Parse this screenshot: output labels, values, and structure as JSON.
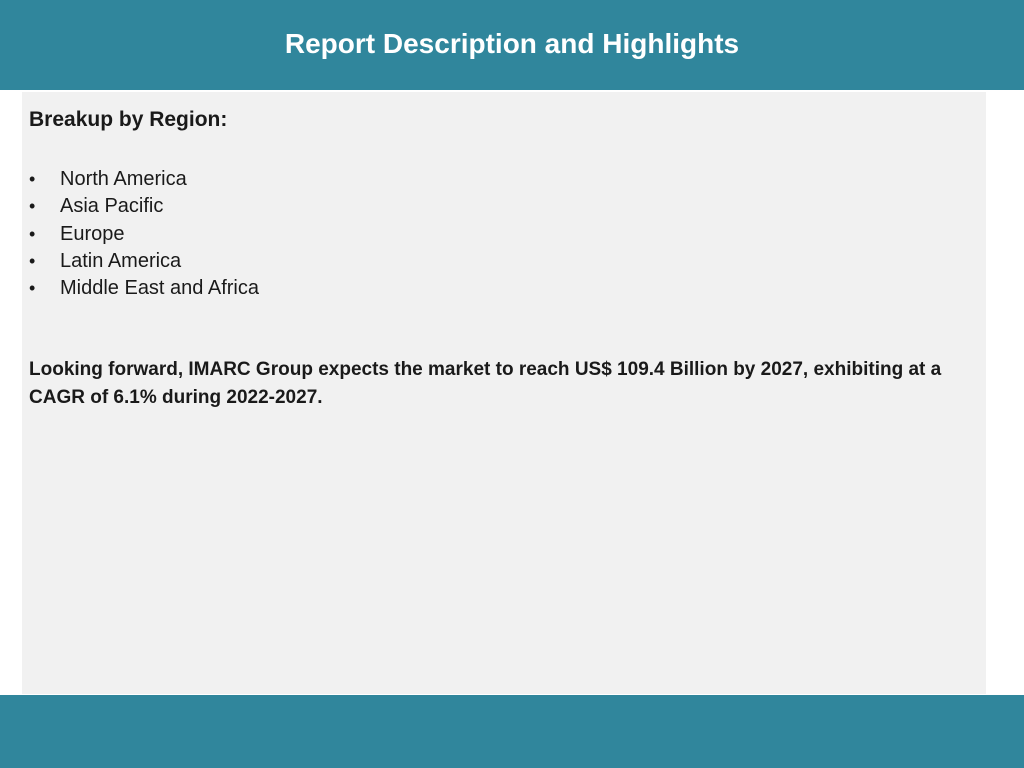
{
  "header": {
    "title": "Report Description and Highlights"
  },
  "content": {
    "section_heading": "Breakup by Region:",
    "bullet_glyph": "•",
    "regions": [
      "North America",
      "Asia Pacific",
      "Europe",
      "Latin America",
      "Middle East and Africa"
    ],
    "forecast": "Looking forward, IMARC Group expects the market to reach US$ 109.4 Billion by 2027, exhibiting at a CAGR of 6.1% during 2022-2027."
  },
  "colors": {
    "header_bar": "#30869c",
    "content_panel": "#f1f1f1",
    "footer_bar": "#30869c",
    "text": "#1a1a1a"
  }
}
